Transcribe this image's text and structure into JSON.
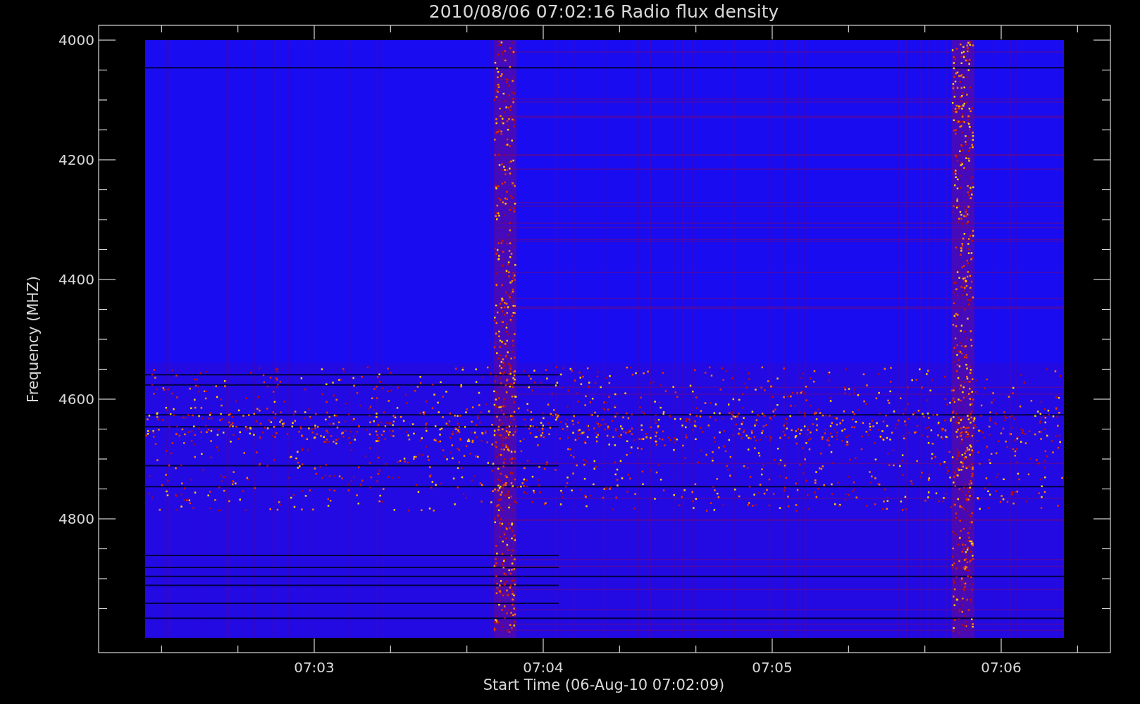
{
  "title": "2010/08/06 07:02:16 Radio flux density",
  "y_axis": {
    "label": "Frequency (MHZ)",
    "tick_labels": [
      "4000",
      "4200",
      "4400",
      "4600",
      "4800"
    ]
  },
  "x_axis": {
    "label": "Start Time (06-Aug-10 07:02:09)",
    "tick_labels": [
      "07:03",
      "07:04",
      "07:05",
      "07:06"
    ]
  }
}
